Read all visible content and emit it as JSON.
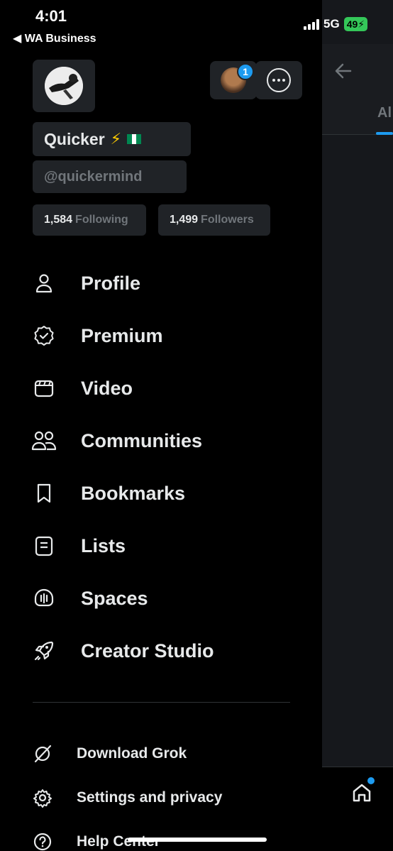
{
  "status_bar": {
    "time": "4:01",
    "back_app": "◀ WA Business",
    "network": "5G",
    "battery": "49"
  },
  "profile": {
    "name": "Quicker",
    "handle": "@quickermind",
    "following_count": "1,584",
    "following_label": "Following",
    "followers_count": "1,499",
    "followers_label": "Followers",
    "account_badge": "1"
  },
  "menu": [
    {
      "label": "Profile",
      "icon": "person-icon"
    },
    {
      "label": "Premium",
      "icon": "verified-badge-icon"
    },
    {
      "label": "Video",
      "icon": "video-icon"
    },
    {
      "label": "Communities",
      "icon": "communities-icon"
    },
    {
      "label": "Bookmarks",
      "icon": "bookmark-icon"
    },
    {
      "label": "Lists",
      "icon": "list-icon"
    },
    {
      "label": "Spaces",
      "icon": "spaces-icon"
    },
    {
      "label": "Creator Studio",
      "icon": "rocket-icon"
    }
  ],
  "secondary_menu": [
    {
      "label": "Download Grok",
      "icon": "grok-icon"
    },
    {
      "label": "Settings and privacy",
      "icon": "gear-icon"
    },
    {
      "label": "Help Center",
      "icon": "help-icon"
    }
  ],
  "background": {
    "tab_label": "Al"
  },
  "colors": {
    "accent": "#1d9bf0",
    "battery": "#34c759",
    "text": "#e7e9ea",
    "muted": "#71767b"
  }
}
